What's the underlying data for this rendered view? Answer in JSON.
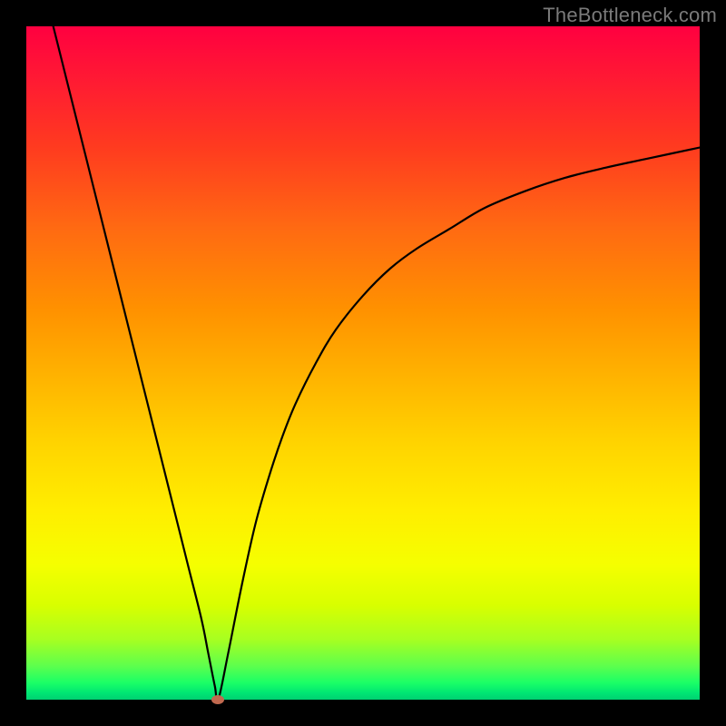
{
  "watermark": "TheBottleneck.com",
  "colors": {
    "frame": "#000000",
    "curve": "#000000",
    "dot": "#c1694f"
  },
  "chart_data": {
    "type": "line",
    "title": "",
    "xlabel": "",
    "ylabel": "",
    "xlim": [
      0,
      100
    ],
    "ylim": [
      0,
      100
    ],
    "grid": false,
    "legend": false,
    "annotations": [],
    "series": [
      {
        "name": "left-branch",
        "x": [
          4,
          6,
          8,
          10,
          12,
          14,
          16,
          18,
          20,
          22,
          24,
          26,
          27,
          28,
          28.5
        ],
        "y": [
          100,
          92,
          84,
          76,
          68,
          60,
          52,
          44,
          36,
          28,
          20,
          12,
          7,
          2,
          0
        ]
      },
      {
        "name": "right-branch",
        "x": [
          28.5,
          30,
          32,
          34,
          36,
          38,
          40,
          43,
          46,
          50,
          54,
          58,
          63,
          68,
          74,
          80,
          86,
          92,
          100
        ],
        "y": [
          0,
          7,
          17,
          26,
          33,
          39,
          44,
          50,
          55,
          60,
          64,
          67,
          70,
          73,
          75.5,
          77.5,
          79,
          80.3,
          82
        ]
      }
    ],
    "marker": {
      "x": 28.5,
      "y": 0,
      "name": "minimum-dot"
    }
  }
}
